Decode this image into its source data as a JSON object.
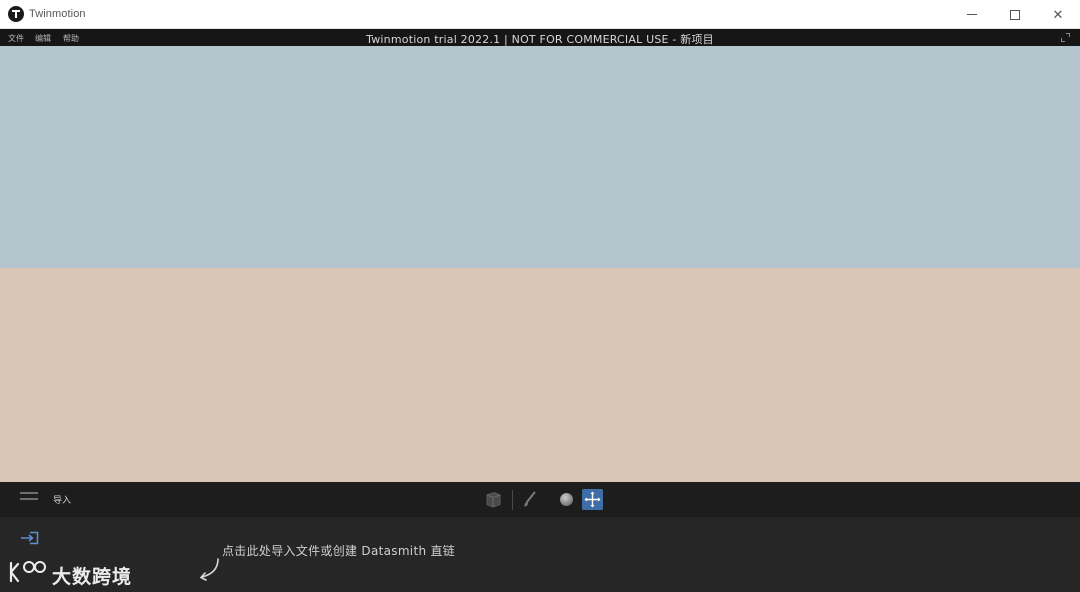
{
  "window": {
    "title": "Twinmotion",
    "minimize_glyph": "—",
    "maximize_glyph": "☐",
    "close_glyph": "✕"
  },
  "menu": {
    "items": [
      "文件",
      "编辑",
      "帮助"
    ],
    "center_title": "Twinmotion trial 2022.1 | NOT FOR COMMERCIAL USE - 新项目"
  },
  "viewport": {
    "sky_color": "#b5c5ce",
    "ground_color": "#d9c6b6"
  },
  "toolbar": {
    "import_label": "导入",
    "accent_color": "#3d6ea8",
    "icons": [
      "menu-icon",
      "cube-icon",
      "brush-icon",
      "sphere-icon",
      "move-icon"
    ]
  },
  "panel": {
    "hint_text": "点击此处导入文件或创建 Datasmith 直链",
    "icons": [
      "import-icon",
      "curved-arrow-icon"
    ]
  },
  "watermark": {
    "text": "大数跨境"
  }
}
